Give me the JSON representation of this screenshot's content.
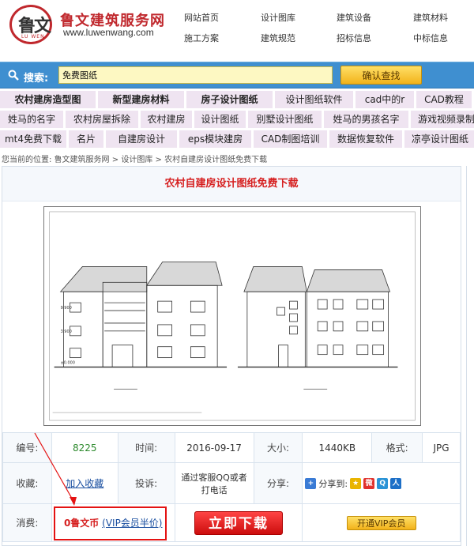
{
  "header": {
    "logo_char": "鲁文",
    "logo_sub": "LU WEN",
    "site_name": "鲁文建筑服务网",
    "site_url": "www.luwenwang.com",
    "nav": [
      "网站首页",
      "设计图库",
      "建筑设备",
      "建筑材料",
      "施工方案",
      "建筑规范",
      "招标信息",
      "中标信息"
    ]
  },
  "search": {
    "label": "搜索:",
    "value": "免费图纸",
    "button": "确认查找"
  },
  "keywords": {
    "row1": [
      "农村建房造型图",
      "新型建房材料",
      "房子设计图纸",
      "设计图纸软件",
      "cad中的r",
      "CAD教程"
    ],
    "row2": [
      "姓马的名字",
      "农村房屋拆除",
      "农村建房",
      "设计图纸",
      "别墅设计图纸",
      "姓马的男孩名字",
      "游戏视频录制"
    ],
    "row3": [
      "mt4免费下载",
      "名片",
      "自建房设计",
      "eps模块建房",
      "CAD制图培训",
      "数据恢复软件",
      "凉亭设计图纸"
    ]
  },
  "breadcrumb": {
    "prefix": "您当前的位置:",
    "items": [
      "鲁文建筑服务网",
      "设计图库",
      "农村自建房设计图纸免费下载"
    ],
    "sep": ">"
  },
  "page_title": "农村自建房设计图纸免费下载",
  "info": {
    "id_label": "编号:",
    "id_value": "8225",
    "time_label": "时间:",
    "time_value": "2016-09-17",
    "size_label": "大小:",
    "size_value": "1440KB",
    "format_label": "格式:",
    "format_value": "JPG",
    "fav_label": "收藏:",
    "fav_link": "加入收藏",
    "complain_label": "投诉:",
    "complain_value": "通过客服QQ或者打电话",
    "share_label": "分享:",
    "share_to": "分享到:",
    "cost_label": "消费:",
    "cost_value": "0鲁文币",
    "vip_half": "(VIP会员半价)",
    "download": "立即下载",
    "vip_open": "开通VIP会员"
  }
}
